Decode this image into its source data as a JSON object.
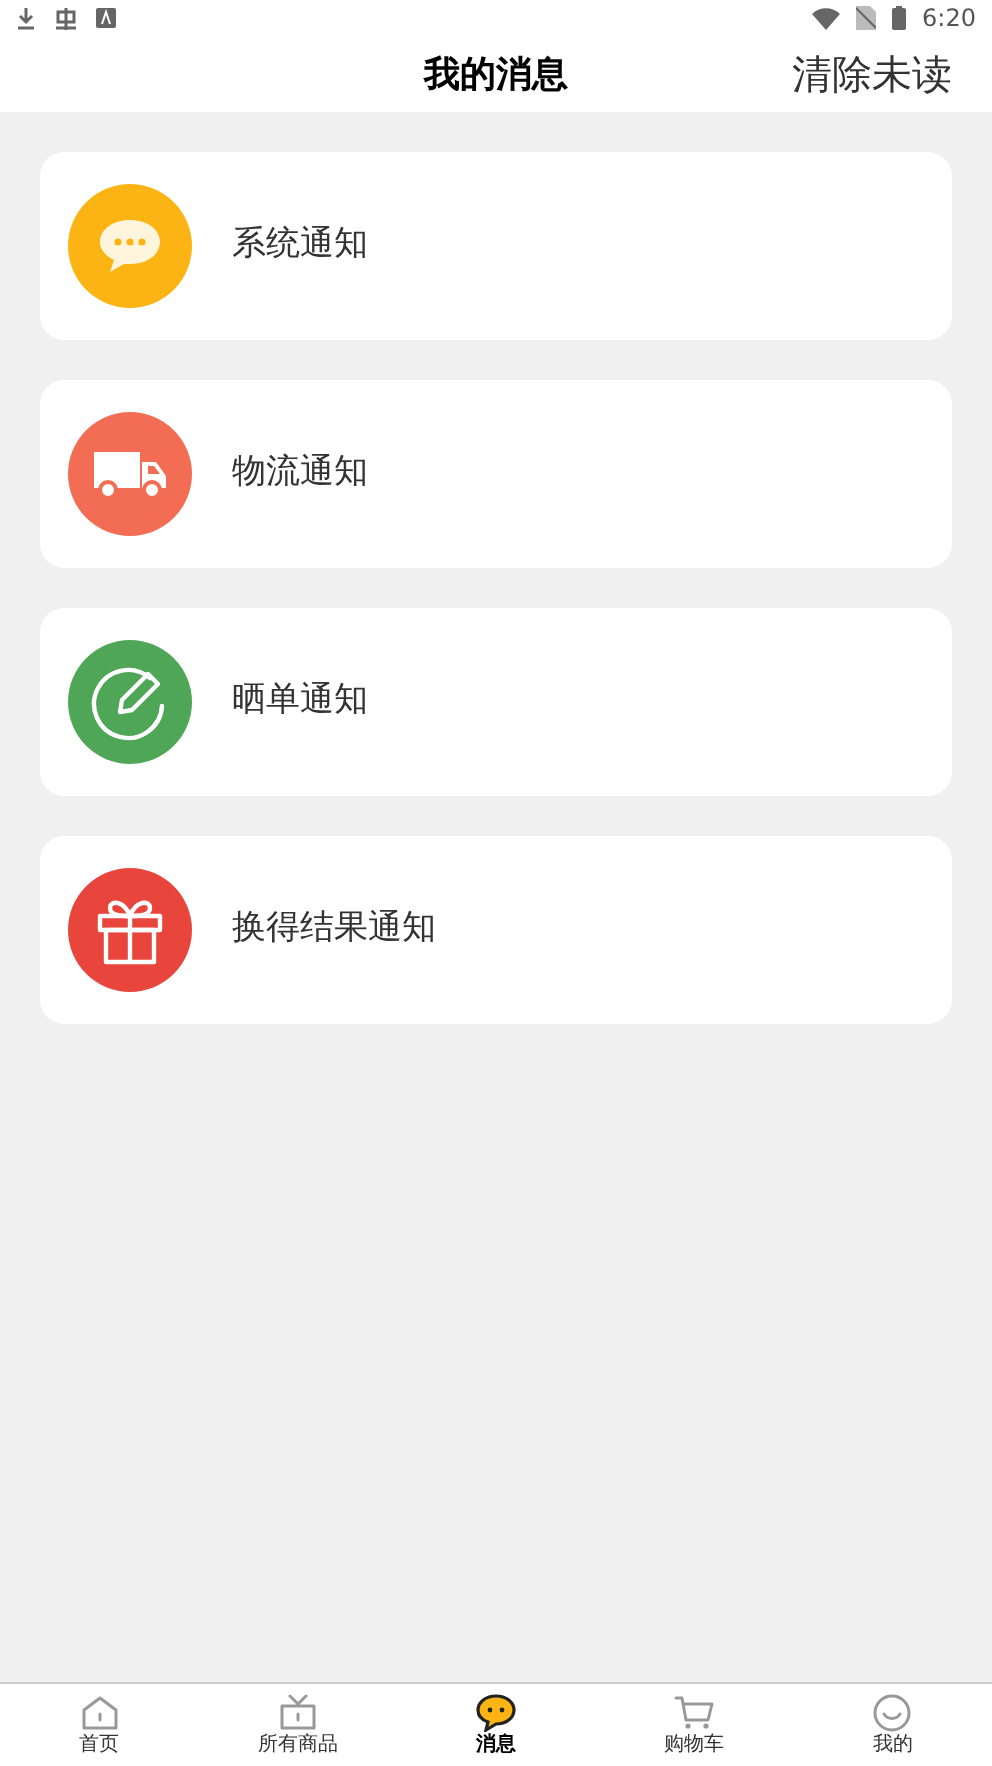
{
  "status_bar": {
    "time": "6:20"
  },
  "header": {
    "title": "我的消息",
    "action": "清除未读"
  },
  "notifications": [
    {
      "kind": "chat",
      "label": "系统通知",
      "color": "#fbb414"
    },
    {
      "kind": "truck",
      "label": "物流通知",
      "color": "#f26d53"
    },
    {
      "kind": "edit",
      "label": "晒单通知",
      "color": "#4fa657"
    },
    {
      "kind": "gift",
      "label": "换得结果通知",
      "color": "#e8453c"
    }
  ],
  "tab_bar": [
    {
      "kind": "home",
      "label": "首页",
      "selected": false
    },
    {
      "kind": "goods",
      "label": "所有商品",
      "selected": false
    },
    {
      "kind": "message",
      "label": "消息",
      "selected": true
    },
    {
      "kind": "cart",
      "label": "购物车",
      "selected": false
    },
    {
      "kind": "me",
      "label": "我的",
      "selected": false
    }
  ]
}
